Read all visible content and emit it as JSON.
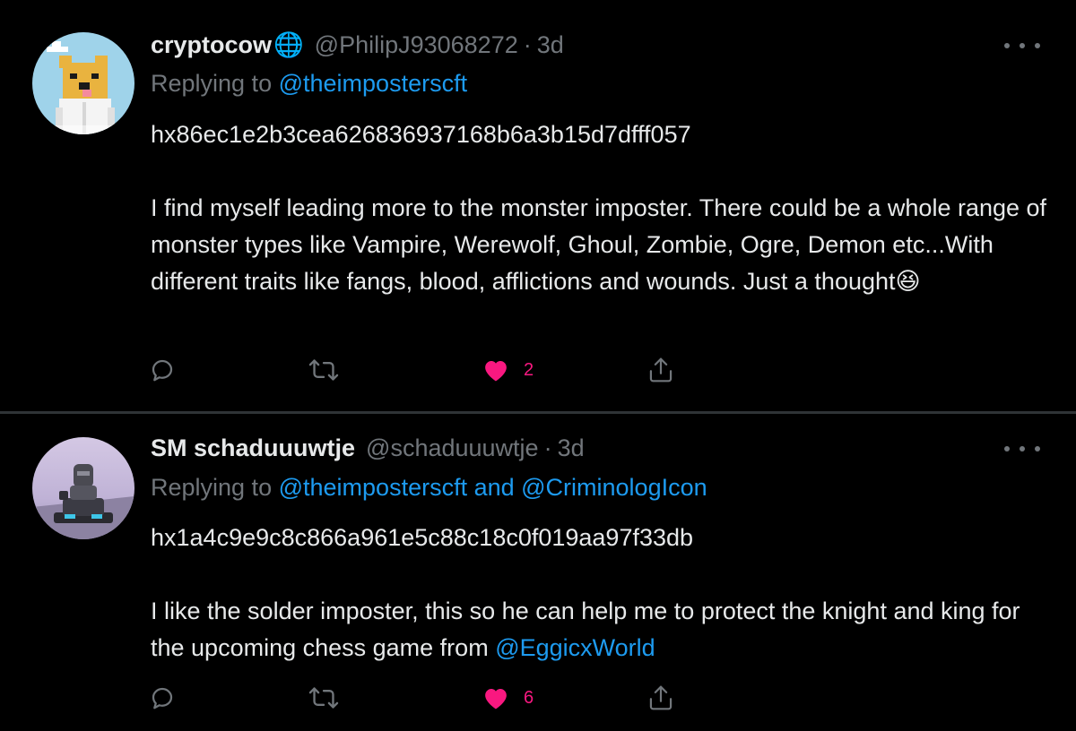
{
  "tweets": [
    {
      "name": "cryptocow",
      "name_emoji": "🌐",
      "handle": "@PhilipJ93068272",
      "separator": "·",
      "time": "3d",
      "replying_prefix": "Replying to",
      "replying_to": "@theimposterscft",
      "body_hash": "hx86ec1e2b3cea626836937168b6a3b15d7dfff057",
      "body_text": "I find myself leading more to the monster imposter. There could be a whole range of monster types like Vampire, Werewolf, Ghoul, Zombie, Ogre, Demon etc...With different traits like fangs, blood, afflictions and wounds. Just a thought",
      "body_emoji": "😆",
      "like_count": "2",
      "liked": true
    },
    {
      "name": "SM schaduuuwtje",
      "handle": "@schaduuuwtje",
      "separator": "·",
      "time": "3d",
      "replying_prefix": "Replying to",
      "replying_to": "@theimposterscft and @CriminologIcon",
      "body_hash": "hx1a4c9e9c8c866a961e5c88c18c0f019aa97f33db",
      "body_text": "I like the solder imposter, this so he can help me to protect the knight and king for the upcoming chess game from ",
      "body_mention": "@EggicxWorld",
      "like_count": "6",
      "liked": true
    }
  ],
  "icons": {
    "reply": "reply-icon",
    "retweet": "retweet-icon",
    "like": "heart-icon",
    "share": "share-icon",
    "more": "more-icon"
  },
  "colors": {
    "background": "#000000",
    "text": "#e7e9ea",
    "muted": "#71767b",
    "link": "#1d9bf0",
    "like": "#f91880",
    "divider": "#2f3336"
  }
}
